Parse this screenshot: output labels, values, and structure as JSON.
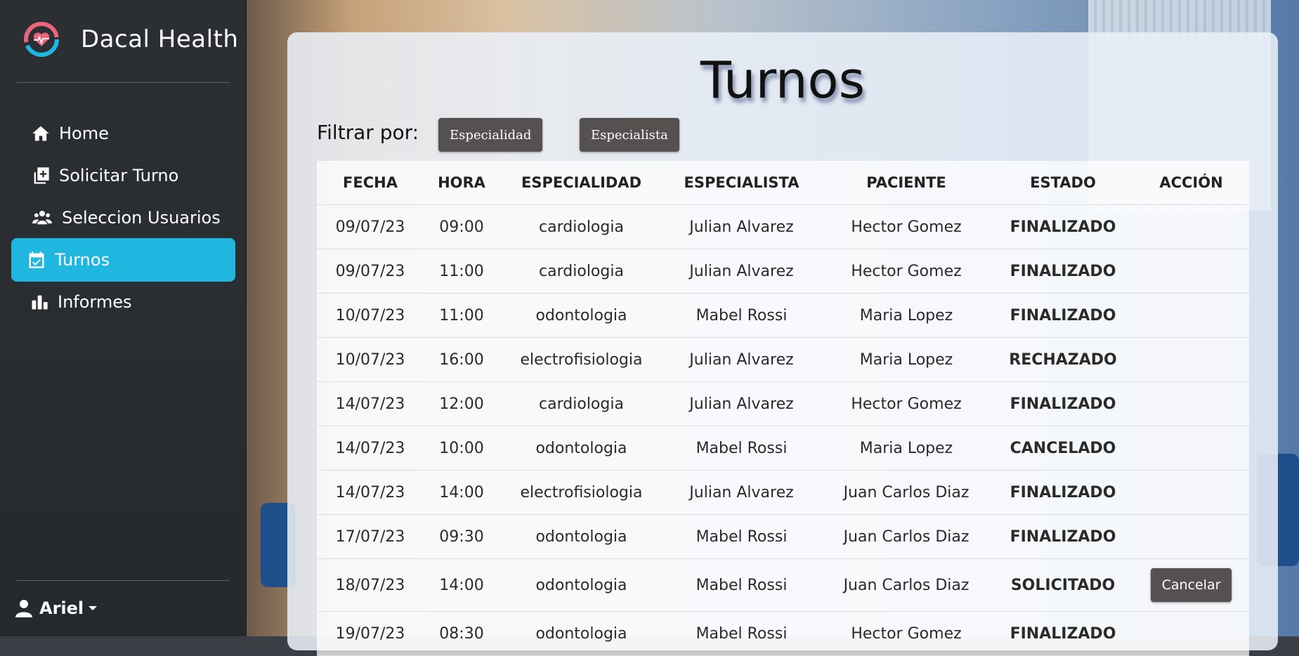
{
  "brand": {
    "name": "Dacal Health"
  },
  "nav": {
    "items": [
      {
        "label": "Home",
        "icon": "home-icon"
      },
      {
        "label": "Solicitar Turno",
        "icon": "calendar-plus-icon"
      },
      {
        "label": "Seleccion Usuarios",
        "icon": "users-icon"
      },
      {
        "label": "Turnos",
        "icon": "calendar-check-icon",
        "active": true
      },
      {
        "label": "Informes",
        "icon": "bar-chart-icon"
      }
    ]
  },
  "user": {
    "name": "Ariel"
  },
  "main": {
    "title": "Turnos",
    "filter_label": "Filtrar por:",
    "filter_buttons": [
      "Especialidad",
      "Especialista"
    ]
  },
  "table": {
    "headers": [
      "FECHA",
      "HORA",
      "ESPECIALIDAD",
      "ESPECIALISTA",
      "PACIENTE",
      "ESTADO",
      "ACCIÓN"
    ],
    "rows": [
      {
        "fecha": "09/07/23",
        "hora": "09:00",
        "especialidad": "cardiologia",
        "especialista": "Julian Alvarez",
        "paciente": "Hector Gomez",
        "estado": "FINALIZADO",
        "accion": ""
      },
      {
        "fecha": "09/07/23",
        "hora": "11:00",
        "especialidad": "cardiologia",
        "especialista": "Julian Alvarez",
        "paciente": "Hector Gomez",
        "estado": "FINALIZADO",
        "accion": ""
      },
      {
        "fecha": "10/07/23",
        "hora": "11:00",
        "especialidad": "odontologia",
        "especialista": "Mabel Rossi",
        "paciente": "Maria Lopez",
        "estado": "FINALIZADO",
        "accion": ""
      },
      {
        "fecha": "10/07/23",
        "hora": "16:00",
        "especialidad": "electrofisiologia",
        "especialista": "Julian Alvarez",
        "paciente": "Maria Lopez",
        "estado": "RECHAZADO",
        "accion": ""
      },
      {
        "fecha": "14/07/23",
        "hora": "12:00",
        "especialidad": "cardiologia",
        "especialista": "Julian Alvarez",
        "paciente": "Hector Gomez",
        "estado": "FINALIZADO",
        "accion": ""
      },
      {
        "fecha": "14/07/23",
        "hora": "10:00",
        "especialidad": "odontologia",
        "especialista": "Mabel Rossi",
        "paciente": "Maria Lopez",
        "estado": "CANCELADO",
        "accion": ""
      },
      {
        "fecha": "14/07/23",
        "hora": "14:00",
        "especialidad": "electrofisiologia",
        "especialista": "Julian Alvarez",
        "paciente": "Juan Carlos Diaz",
        "estado": "FINALIZADO",
        "accion": ""
      },
      {
        "fecha": "17/07/23",
        "hora": "09:30",
        "especialidad": "odontologia",
        "especialista": "Mabel Rossi",
        "paciente": "Juan Carlos Diaz",
        "estado": "FINALIZADO",
        "accion": ""
      },
      {
        "fecha": "18/07/23",
        "hora": "14:00",
        "especialidad": "odontologia",
        "especialista": "Mabel Rossi",
        "paciente": "Juan Carlos Diaz",
        "estado": "SOLICITADO",
        "accion": "Cancelar"
      },
      {
        "fecha": "19/07/23",
        "hora": "08:30",
        "especialidad": "odontologia",
        "especialista": "Mabel Rossi",
        "paciente": "Hector Gomez",
        "estado": "FINALIZADO",
        "accion": ""
      }
    ]
  },
  "colors": {
    "accent": "#1fb6e0",
    "sidebar": "#2b2f33",
    "button": "#555150"
  }
}
